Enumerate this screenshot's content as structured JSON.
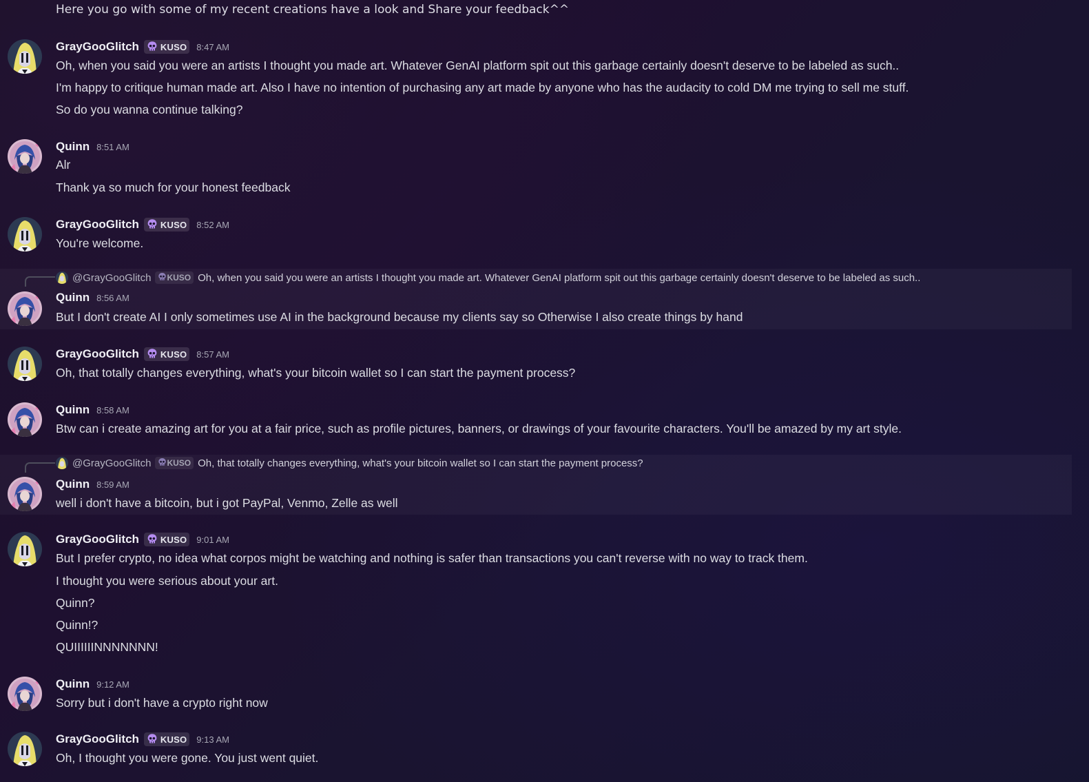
{
  "top_message": "Here you go with some of my recent creations have a look and Share your feedback^^",
  "users": {
    "gray": {
      "name": "GrayGooGlitch",
      "tag": "KUSO",
      "tag_icon": "skull-icon"
    },
    "quinn": {
      "name": "Quinn"
    }
  },
  "messages": [
    {
      "author": "GrayGooGlitch",
      "tag": "KUSO",
      "time": "8:47 AM",
      "lines": [
        "Oh, when you said you were an artists I thought you made art. Whatever GenAI platform spit out this garbage certainly doesn't deserve to be labeled as such..",
        "I'm happy to critique human made art. Also I have no intention of purchasing any art made by anyone who has the audacity to cold DM me trying to sell me stuff.",
        "So do you wanna continue talking?"
      ]
    },
    {
      "author": "Quinn",
      "time": "8:51 AM",
      "lines": [
        "Alr",
        "Thank ya so much for your honest feedback"
      ]
    },
    {
      "author": "GrayGooGlitch",
      "tag": "KUSO",
      "time": "8:52 AM",
      "lines": [
        "You're welcome."
      ]
    },
    {
      "author": "Quinn",
      "time": "8:56 AM",
      "reply_to": {
        "name": "@GrayGooGlitch",
        "tag": "KUSO",
        "text": "Oh, when you said you were an artists I thought you made art. Whatever GenAI platform spit out this garbage certainly doesn't deserve to be labeled as such.."
      },
      "lines": [
        "But I don't create AI I only sometimes use AI in the background because my clients say so Otherwise I also create things by hand"
      ]
    },
    {
      "author": "GrayGooGlitch",
      "tag": "KUSO",
      "time": "8:57 AM",
      "lines": [
        "Oh, that totally changes everything, what's your bitcoin wallet so I can start the payment process?"
      ]
    },
    {
      "author": "Quinn",
      "time": "8:58 AM",
      "lines": [
        "Btw can i create amazing art for you at a fair price, such as profile pictures, banners, or drawings of your favourite characters. You'll be amazed by my art style."
      ]
    },
    {
      "author": "Quinn",
      "time": "8:59 AM",
      "reply_to": {
        "name": "@GrayGooGlitch",
        "tag": "KUSO",
        "text": "Oh, that totally changes everything, what's your bitcoin wallet so I can start the payment process?"
      },
      "lines": [
        "well i don't have a bitcoin, but i got PayPal, Venmo, Zelle as well"
      ]
    },
    {
      "author": "GrayGooGlitch",
      "tag": "KUSO",
      "time": "9:01 AM",
      "lines": [
        "But I prefer crypto, no idea what corpos might be watching and nothing is safer than transactions you can't reverse with no way to track them.",
        "I thought you were serious about your art.",
        "Quinn?",
        "Quinn!?",
        "QUIIIIIINNNNNNN!"
      ]
    },
    {
      "author": "Quinn",
      "time": "9:12 AM",
      "lines": [
        "Sorry but i don't have a crypto right now"
      ]
    },
    {
      "author": "GrayGooGlitch",
      "tag": "KUSO",
      "time": "9:13 AM",
      "lines": [
        "Oh, I thought you were gone. You just went quiet."
      ]
    }
  ]
}
